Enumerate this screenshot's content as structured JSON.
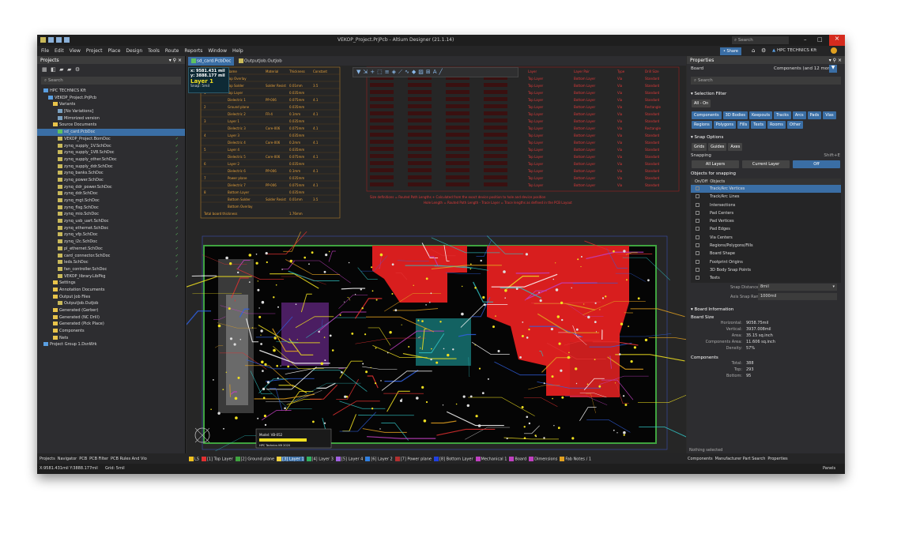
{
  "window": {
    "title": "VEKOP_Project.PrjPcb - Altium Designer (21.1.14)",
    "search_label": "Search",
    "share_label": "Share",
    "account_label": "HPC TECHNICS Kft"
  },
  "menu": [
    "File",
    "Edit",
    "View",
    "Project",
    "Place",
    "Design",
    "Tools",
    "Route",
    "Reports",
    "Window",
    "Help"
  ],
  "projects_panel": {
    "title": "Projects",
    "search_placeholder": "Search",
    "items": [
      "HPC TECHNICS Kft",
      "VEKOP_Project.PrjPcb",
      "Variants",
      "[No Variations]",
      "Mirrorized version",
      "Source Documents",
      "sd_card.PcbDoc",
      "VEKOP_Project.BomDoc",
      "zynq_supply_1V.SchDoc",
      "zynq_supply_1V8.SchDoc",
      "zynq_supply_other.SchDoc",
      "zynq_supply_ddr.SchDoc",
      "zynq_banks.SchDoc",
      "zynq_power.SchDoc",
      "zynq_ddr_power.SchDoc",
      "zynq_ddr.SchDoc",
      "zynq_mgt.SchDoc",
      "zynq_flsg.SchDoc",
      "zynq_mio.SchDoc",
      "zynq_usb_uart.SchDoc",
      "zynq_ethernet.SchDoc",
      "zynq_vfp.SchDoc",
      "zynq_i2c.SchDoc",
      "pl_ethernet.SchDoc",
      "card_connector.SchDoc",
      "leds.SchDoc",
      "fan_controller.SchDoc",
      "VEKOP_library.LibPkg",
      "Settings",
      "Annotation Documents",
      "Output Job Files",
      "OutputJob.OutJob",
      "Generated (Gerber)",
      "Generated (NC Drill)",
      "Generated (Pick Place)",
      "Components",
      "Nets",
      "Project Group 1.DsnWrk"
    ]
  },
  "doc_tabs": [
    "sd_card.PcbDoc",
    "OutputJob.OutJob"
  ],
  "coord_box": {
    "x": "x: 9581.431 mil",
    "y": "y: 3888.177 mil",
    "layer": "Layer 1",
    "snap": "Snap: 5mil"
  },
  "properties_panel": {
    "title": "Properties",
    "board_label": "Board",
    "components_filter": "Components (and 12 more)",
    "search_placeholder": "Search",
    "selection_filter_title": "Selection Filter",
    "all_on": "All - On",
    "filter_buttons": [
      "Components",
      "3D Bodies",
      "Keepouts",
      "Tracks",
      "Arcs",
      "Pads",
      "Vias",
      "Regions",
      "Polygons",
      "Fills",
      "Texts",
      "Rooms",
      "Other"
    ],
    "snap_options_title": "Snap Options",
    "snap_buttons": [
      "Grids",
      "Guides",
      "Axes"
    ],
    "snapping_label": "Snapping",
    "snapping_shortcut": "Shift+E",
    "snapping_modes": [
      "All Layers",
      "Current Layer",
      "Off"
    ],
    "objects_title": "Objects for snapping",
    "objects_header": [
      "On/Off",
      "Objects"
    ],
    "objects": [
      "Track/Arc Vertices",
      "Track/Arc Lines",
      "Intersections",
      "Pad Centers",
      "Pad Vertices",
      "Pad Edges",
      "Via Centers",
      "Regions/Polygons/Fills",
      "Board Shape",
      "Footprint Origins",
      "3D Body Snap Points",
      "Texts"
    ],
    "snap_distance_label": "Snap Distance",
    "snap_distance_value": "8mil",
    "axis_snap_label": "Axis Snap Range",
    "axis_snap_value": "1000mil",
    "board_info_title": "Board Information",
    "board_size_title": "Board Size",
    "board_size": [
      {
        "k": "Horizontal:",
        "v": "9058.75mil"
      },
      {
        "k": "Vertical:",
        "v": "3937.008mil"
      },
      {
        "k": "Area:",
        "v": "35.15 sq.inch"
      },
      {
        "k": "Components Area:",
        "v": "11.606 sq.inch"
      },
      {
        "k": "Density:",
        "v": "57%"
      }
    ],
    "components_title": "Components",
    "components_stats": [
      {
        "k": "Total:",
        "v": "388"
      },
      {
        "k": "Top:",
        "v": "293"
      },
      {
        "k": "Bottom:",
        "v": "95"
      }
    ],
    "nothing_selected": "Nothing selected"
  },
  "stack_table_left": {
    "header": [
      "#",
      "Name",
      "Material",
      "Thickness",
      "Constant"
    ],
    "rows": [
      [
        "",
        "Top Overlay",
        "",
        "",
        ""
      ],
      [
        "",
        "Top Solder",
        "Solder Resist",
        "0.01mm",
        "3.5"
      ],
      [
        "1",
        "Top Layer",
        "",
        "0.035mm",
        ""
      ],
      [
        "",
        "Dielectric 1",
        "PP-006",
        "0.075mm",
        "4.1"
      ],
      [
        "2",
        "Ground plane",
        "",
        "0.035mm",
        ""
      ],
      [
        "",
        "Dielectric 2",
        "FR-4",
        "0.1mm",
        "4.1"
      ],
      [
        "3",
        "Layer 1",
        "",
        "0.035mm",
        ""
      ],
      [
        "",
        "Dielectric 3",
        "Core-006",
        "0.075mm",
        "4.1"
      ],
      [
        "4",
        "Layer 3",
        "",
        "0.035mm",
        ""
      ],
      [
        "",
        "Dielectric 4",
        "Core-006",
        "0.2mm",
        "4.1"
      ],
      [
        "5",
        "Layer 4",
        "",
        "0.035mm",
        ""
      ],
      [
        "",
        "Dielectric 5",
        "Core-006",
        "0.075mm",
        "4.1"
      ],
      [
        "6",
        "Layer 2",
        "",
        "0.035mm",
        ""
      ],
      [
        "",
        "Dielectric 6",
        "PP-006",
        "0.1mm",
        "4.1"
      ],
      [
        "7",
        "Power plane",
        "",
        "0.035mm",
        ""
      ],
      [
        "",
        "Dielectric 7",
        "PP-006",
        "0.075mm",
        "4.1"
      ],
      [
        "8",
        "Bottom Layer",
        "",
        "0.035mm",
        ""
      ],
      [
        "",
        "Bottom Solder",
        "Solder Resist",
        "0.01mm",
        "3.5"
      ],
      [
        "",
        "Bottom Overlay",
        "",
        "",
        ""
      ]
    ],
    "total": "Total board thickness",
    "total_value": "1.76mm"
  },
  "stack_table_right": {
    "header": [
      "Layer",
      "Layer Pair",
      "Type",
      "Drill Size"
    ],
    "rows": [
      [
        "Top Layer",
        "Bottom Layer",
        "Via",
        "Standard"
      ],
      [
        "Top Layer",
        "Bottom Layer",
        "Via",
        "Standard"
      ],
      [
        "Top Layer",
        "Bottom Layer",
        "Via",
        "Standard"
      ],
      [
        "Top Layer",
        "Bottom Layer",
        "Via",
        "Standard"
      ],
      [
        "Top Layer",
        "Bottom Layer",
        "Via",
        "Rectangle"
      ],
      [
        "Top Layer",
        "Bottom Layer",
        "Via",
        "Standard"
      ],
      [
        "Top Layer",
        "Bottom Layer",
        "Via",
        "Standard"
      ],
      [
        "Top Layer",
        "Bottom Layer",
        "Via",
        "Rectangle"
      ],
      [
        "Top Layer",
        "Bottom Layer",
        "Via",
        "Standard"
      ],
      [
        "Top Layer",
        "Bottom Layer",
        "Via",
        "Standard"
      ],
      [
        "Top Layer",
        "Bottom Layer",
        "Via",
        "Standard"
      ],
      [
        "Top Layer",
        "Bottom Layer",
        "Via",
        "Standard"
      ],
      [
        "Top Layer",
        "Bottom Layer",
        "Via",
        "Standard"
      ],
      [
        "Top Layer",
        "Bottom Layer",
        "Via",
        "Standard"
      ],
      [
        "Top Layer",
        "Bottom Layer",
        "Via",
        "Standard"
      ],
      [
        "Top Layer",
        "Bottom Layer",
        "Via",
        "Standard"
      ]
    ],
    "note1": "Size definitions = Routed Path Lengths + Calculated from the exact device position to hole and device position",
    "note2": "Hole Length = Routed Path Length - Trace Layer = Trace lengths as defined in the PCB Layout"
  },
  "board_labels": {
    "label1": "Model: VB-052",
    "label2": "HPC Technics Kft 2020"
  },
  "bottom_panel_tabs": [
    "Projects",
    "Navigator",
    "PCB",
    "PCB Filter",
    "PCB Rules And Vio"
  ],
  "layer_tabs": [
    {
      "name": "LS",
      "color": "#f0c020"
    },
    {
      "name": "[1] Top Layer",
      "color": "#e03030"
    },
    {
      "name": "[2] Ground plane",
      "color": "#3fa33f"
    },
    {
      "name": "[3] Layer 1",
      "color": "#f0d040"
    },
    {
      "name": "[4] Layer 3",
      "color": "#30b060"
    },
    {
      "name": "[5] Layer 4",
      "color": "#a060e0"
    },
    {
      "name": "[6] Layer 2",
      "color": "#3080e0"
    },
    {
      "name": "[7] Power plane",
      "color": "#b03030"
    },
    {
      "name": "[8] Bottom Layer",
      "color": "#2040e0"
    },
    {
      "name": "Mechanical 1",
      "color": "#c040c0"
    },
    {
      "name": "Board",
      "color": "#c040c0"
    },
    {
      "name": "Dimensions",
      "color": "#c040c0"
    },
    {
      "name": "Fab Notes / 1",
      "color": "#e0a020"
    }
  ],
  "right_bottom_tabs": [
    "Components",
    "Manufacturer Part Search",
    "Properties"
  ],
  "status": {
    "coords": "X:9581.431mil Y:3888.177mil",
    "grid": "Grid: 5mil",
    "panels": "Panels"
  }
}
